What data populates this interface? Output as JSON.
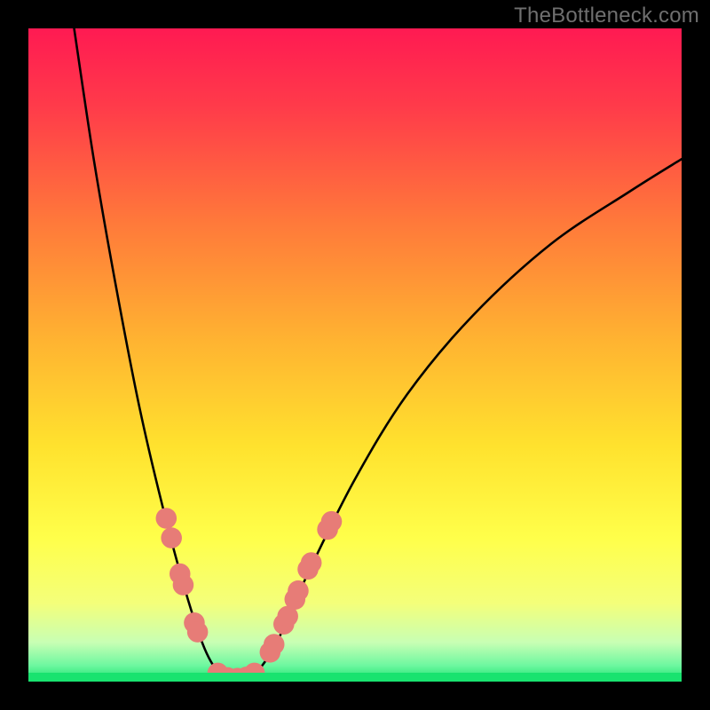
{
  "watermark": "TheBottleneck.com",
  "chart_data": {
    "type": "line",
    "title": "",
    "xlabel": "",
    "ylabel": "",
    "xlim": [
      0,
      100
    ],
    "ylim": [
      0,
      100
    ],
    "gradient_stops": [
      {
        "offset": 0.0,
        "color": "#ff1a52"
      },
      {
        "offset": 0.12,
        "color": "#ff3b4a"
      },
      {
        "offset": 0.3,
        "color": "#ff7a3a"
      },
      {
        "offset": 0.48,
        "color": "#ffb431"
      },
      {
        "offset": 0.64,
        "color": "#ffe22e"
      },
      {
        "offset": 0.78,
        "color": "#ffff4a"
      },
      {
        "offset": 0.88,
        "color": "#f4ff7a"
      },
      {
        "offset": 0.94,
        "color": "#c8ffb4"
      },
      {
        "offset": 0.975,
        "color": "#6ef7a0"
      },
      {
        "offset": 1.0,
        "color": "#19e36f"
      }
    ],
    "series": [
      {
        "name": "bottleneck-curve",
        "points": [
          {
            "x": 7.0,
            "y": 100.0
          },
          {
            "x": 10.0,
            "y": 80.0
          },
          {
            "x": 13.5,
            "y": 60.0
          },
          {
            "x": 17.0,
            "y": 42.0
          },
          {
            "x": 20.5,
            "y": 27.0
          },
          {
            "x": 24.0,
            "y": 14.0
          },
          {
            "x": 27.0,
            "y": 5.0
          },
          {
            "x": 29.5,
            "y": 1.0
          },
          {
            "x": 32.0,
            "y": 0.3
          },
          {
            "x": 34.5,
            "y": 1.0
          },
          {
            "x": 38.0,
            "y": 6.0
          },
          {
            "x": 43.0,
            "y": 17.0
          },
          {
            "x": 50.0,
            "y": 31.0
          },
          {
            "x": 58.0,
            "y": 44.0
          },
          {
            "x": 68.0,
            "y": 56.0
          },
          {
            "x": 80.0,
            "y": 67.0
          },
          {
            "x": 92.0,
            "y": 75.0
          },
          {
            "x": 100.0,
            "y": 80.0
          }
        ]
      }
    ],
    "markers": {
      "name": "highlighted-points",
      "color": "#e77c77",
      "radius": 1.6,
      "points": [
        {
          "x": 21.1,
          "y": 25.0
        },
        {
          "x": 21.9,
          "y": 22.0
        },
        {
          "x": 23.2,
          "y": 16.5
        },
        {
          "x": 23.7,
          "y": 14.8
        },
        {
          "x": 25.4,
          "y": 9.0
        },
        {
          "x": 25.9,
          "y": 7.6
        },
        {
          "x": 29.0,
          "y": 1.3
        },
        {
          "x": 30.5,
          "y": 0.6
        },
        {
          "x": 32.0,
          "y": 0.5
        },
        {
          "x": 33.4,
          "y": 0.7
        },
        {
          "x": 34.6,
          "y": 1.3
        },
        {
          "x": 37.0,
          "y": 4.5
        },
        {
          "x": 37.6,
          "y": 5.7
        },
        {
          "x": 39.1,
          "y": 8.8
        },
        {
          "x": 39.7,
          "y": 10.0
        },
        {
          "x": 40.8,
          "y": 12.6
        },
        {
          "x": 41.3,
          "y": 13.9
        },
        {
          "x": 42.8,
          "y": 17.2
        },
        {
          "x": 43.3,
          "y": 18.2
        },
        {
          "x": 45.8,
          "y": 23.3
        },
        {
          "x": 46.4,
          "y": 24.5
        }
      ]
    }
  }
}
